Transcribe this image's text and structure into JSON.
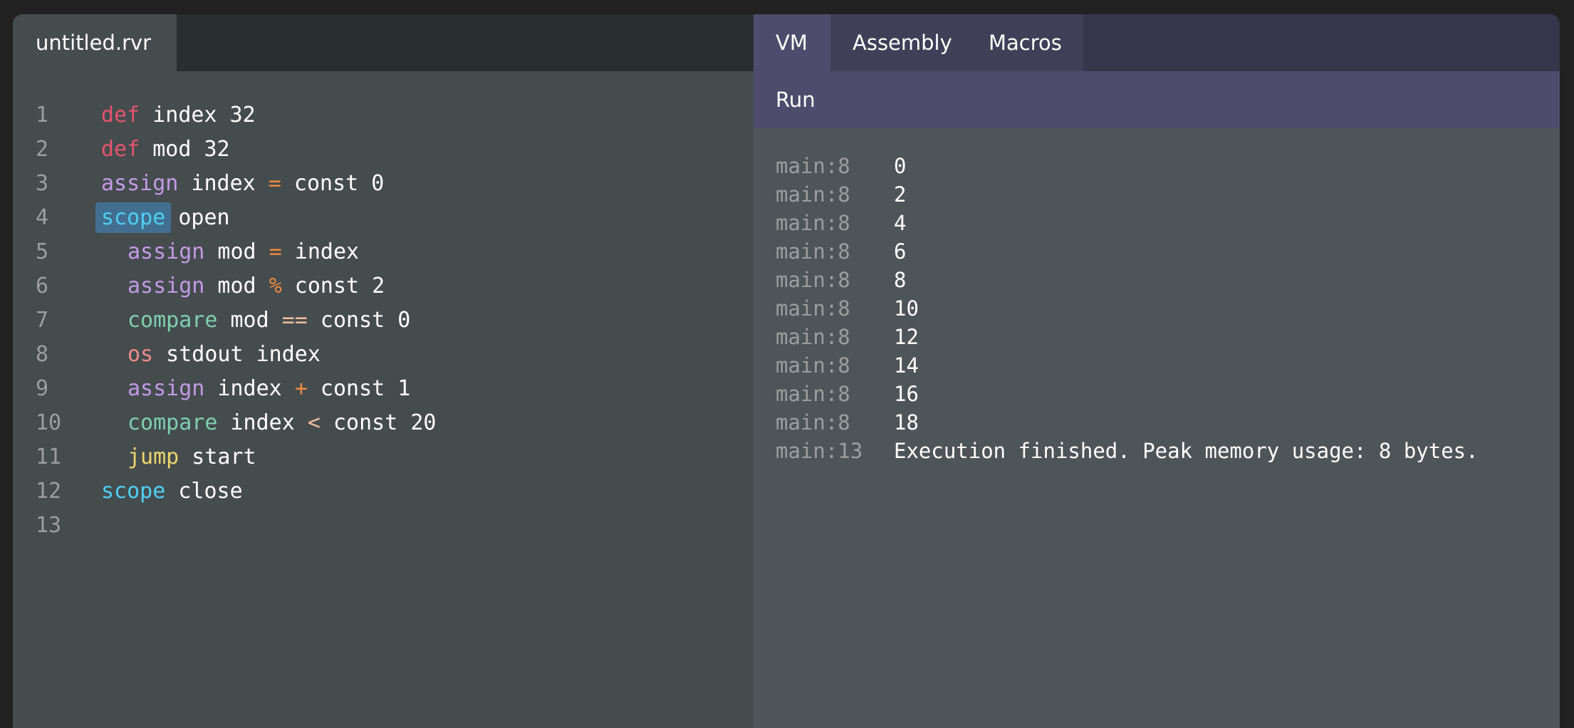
{
  "editor": {
    "tab_label": "untitled.rvr",
    "lines": [
      {
        "n": "1",
        "indent": 0,
        "tokens": [
          {
            "t": "def",
            "k": "def"
          },
          {
            "t": " index 32",
            "k": "plain"
          }
        ]
      },
      {
        "n": "2",
        "indent": 0,
        "tokens": [
          {
            "t": "def",
            "k": "def"
          },
          {
            "t": " mod 32",
            "k": "plain"
          }
        ]
      },
      {
        "n": "3",
        "indent": 0,
        "tokens": [
          {
            "t": "assign",
            "k": "assign"
          },
          {
            "t": " index ",
            "k": "plain"
          },
          {
            "t": "=",
            "k": "op"
          },
          {
            "t": " const 0",
            "k": "plain"
          }
        ]
      },
      {
        "n": "4",
        "indent": 0,
        "tokens": [
          {
            "t": "scope",
            "k": "scope",
            "selected": true
          },
          {
            "t": " open",
            "k": "plain"
          }
        ]
      },
      {
        "n": "5",
        "indent": 1,
        "tokens": [
          {
            "t": "assign",
            "k": "assign"
          },
          {
            "t": " mod ",
            "k": "plain"
          },
          {
            "t": "=",
            "k": "op"
          },
          {
            "t": " index",
            "k": "plain"
          }
        ]
      },
      {
        "n": "6",
        "indent": 1,
        "tokens": [
          {
            "t": "assign",
            "k": "assign"
          },
          {
            "t": " mod ",
            "k": "plain"
          },
          {
            "t": "%",
            "k": "op"
          },
          {
            "t": " const 2",
            "k": "plain"
          }
        ]
      },
      {
        "n": "7",
        "indent": 1,
        "tokens": [
          {
            "t": "compare",
            "k": "compare"
          },
          {
            "t": " mod ",
            "k": "plain"
          },
          {
            "t": "==",
            "k": "cmp"
          },
          {
            "t": " const 0",
            "k": "plain"
          }
        ]
      },
      {
        "n": "8",
        "indent": 1,
        "tokens": [
          {
            "t": "os",
            "k": "os"
          },
          {
            "t": " stdout index",
            "k": "plain"
          }
        ]
      },
      {
        "n": "9",
        "indent": 1,
        "tokens": [
          {
            "t": "assign",
            "k": "assign"
          },
          {
            "t": " index ",
            "k": "plain"
          },
          {
            "t": "+",
            "k": "op"
          },
          {
            "t": " const 1",
            "k": "plain"
          }
        ]
      },
      {
        "n": "10",
        "indent": 1,
        "tokens": [
          {
            "t": "compare",
            "k": "compare"
          },
          {
            "t": " index ",
            "k": "plain"
          },
          {
            "t": "<",
            "k": "cmp"
          },
          {
            "t": " const 20",
            "k": "plain"
          }
        ]
      },
      {
        "n": "11",
        "indent": 1,
        "tokens": [
          {
            "t": "jump",
            "k": "jump"
          },
          {
            "t": " start",
            "k": "plain"
          }
        ]
      },
      {
        "n": "12",
        "indent": 0,
        "tokens": [
          {
            "t": "scope",
            "k": "scope"
          },
          {
            "t": " close",
            "k": "plain"
          }
        ]
      },
      {
        "n": "13",
        "indent": 0,
        "tokens": []
      }
    ]
  },
  "vm": {
    "tabs": [
      {
        "label": "VM",
        "active": true
      },
      {
        "label": "Assembly",
        "active": false
      },
      {
        "label": "Macros",
        "active": false
      }
    ],
    "run_label": "Run",
    "output": [
      {
        "loc": "main:8",
        "msg": "0"
      },
      {
        "loc": "main:8",
        "msg": "2"
      },
      {
        "loc": "main:8",
        "msg": "4"
      },
      {
        "loc": "main:8",
        "msg": "6"
      },
      {
        "loc": "main:8",
        "msg": "8"
      },
      {
        "loc": "main:8",
        "msg": "10"
      },
      {
        "loc": "main:8",
        "msg": "12"
      },
      {
        "loc": "main:8",
        "msg": "14"
      },
      {
        "loc": "main:8",
        "msg": "16"
      },
      {
        "loc": "main:8",
        "msg": "18"
      },
      {
        "loc": "main:13",
        "msg": "Execution finished. Peak memory usage: 8 bytes."
      }
    ]
  },
  "colors": {
    "keyword_def": "#e4546e",
    "keyword_assign": "#c39ae6",
    "keyword_scope": "#4fd0f2",
    "keyword_compare": "#7ecfb0",
    "keyword_os": "#ee8b88",
    "keyword_jump": "#ecd56d",
    "operator": "#ef8a3f",
    "comparison_operator": "#f0bf9c",
    "selection": "#426f91",
    "vm_tab_active": "#4e4c6c"
  }
}
